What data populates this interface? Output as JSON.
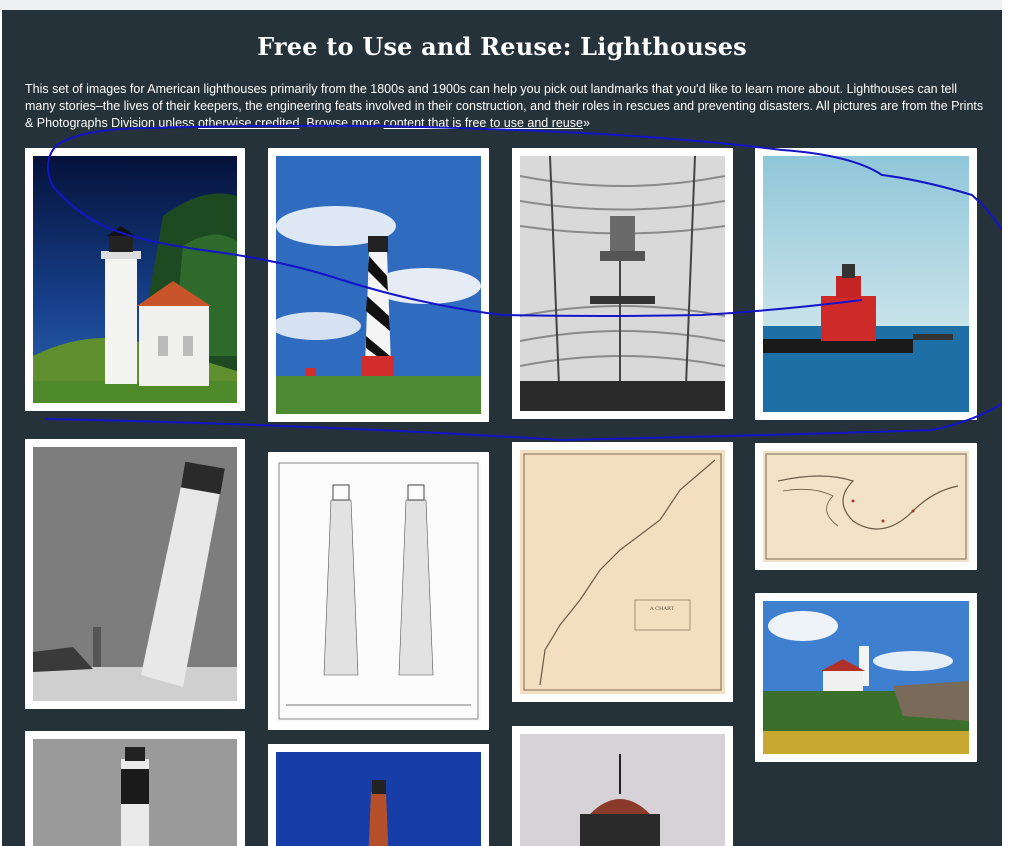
{
  "page": {
    "title": "Free to Use and Reuse: Lighthouses",
    "intro_text": "This set of images for American lighthouses primarily from the 1800s and 1900s can help you pick out landmarks that you'd like to learn more about. Lighthouses can tell many stories–the lives of their keepers, the engineering feats involved in their construction, and their roles in rescues and preventing disasters. All pictures are from the Prints & Photographs Division unless ",
    "otherwise_link": "otherwise credited",
    "after_otherwise": ". Browse more ",
    "content_link": "content that is free to use and reuse",
    "chevron": "»"
  },
  "images": [
    {
      "name": "white-lighthouse-photo",
      "alt": "White lighthouse with red-roof keeper's house"
    },
    {
      "name": "striped-lighthouse-photo",
      "alt": "Black and white striped lighthouse under blue sky"
    },
    {
      "name": "lens-interior-photo",
      "alt": "Interior of lighthouse Fresnel lens"
    },
    {
      "name": "red-pier-lighthouse-photo",
      "alt": "Red lighthouse on pier in blue water"
    },
    {
      "name": "leaning-lighthouse-photo",
      "alt": "Leaning lighthouse tower on beach"
    },
    {
      "name": "lighthouse-drawing",
      "alt": "Architectural elevation drawing of two lighthouse towers"
    },
    {
      "name": "coast-chart-map",
      "alt": "A chart exhibiting the light houses, light vessels on the coasts of the United States"
    },
    {
      "name": "great-lakes-map",
      "alt": "Map of lights on the Great Lakes"
    },
    {
      "name": "coastal-lighthouse-photo",
      "alt": "Lighthouse on rocky coast with flowers"
    },
    {
      "name": "bw-lighthouse-photo",
      "alt": "Black and white banded lighthouse tower"
    },
    {
      "name": "red-tower-lighthouse-photo",
      "alt": "Red lighthouse tower against deep blue sky"
    },
    {
      "name": "lantern-room-photo",
      "alt": "Lighthouse lantern room close-up"
    }
  ],
  "colors": {
    "panel_bg": "#25323a",
    "annotation_stroke": "#1414c8"
  }
}
